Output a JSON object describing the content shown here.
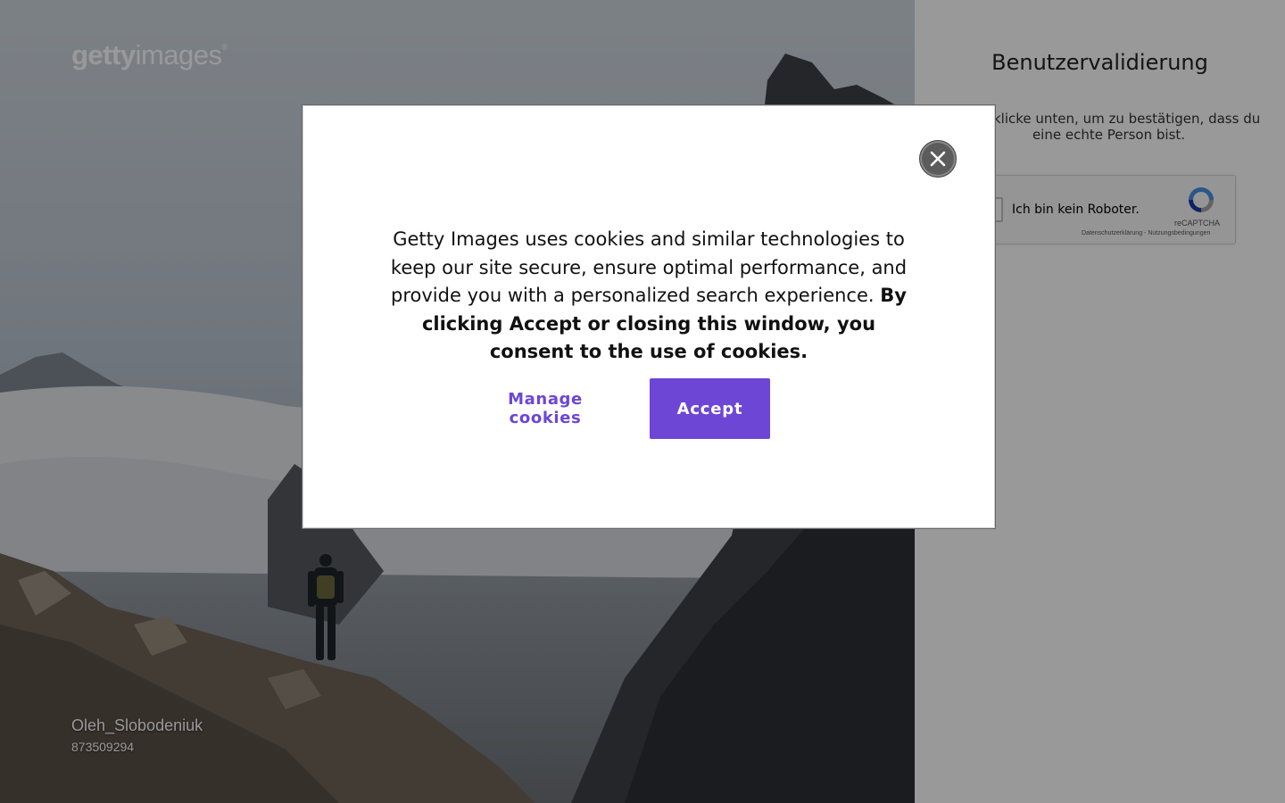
{
  "background": {
    "logo_bold": "getty",
    "logo_light": "images",
    "logo_mark": "®",
    "photographer": "Oleh_Slobodeniuk",
    "image_id": "873509294"
  },
  "validation": {
    "title": "Benutzervalidierung",
    "instructions": "Bitte klicke unten, um zu bestätigen, dass du eine echte Person bist.",
    "captcha": {
      "checkbox_label": "Ich bin kein Roboter.",
      "brand": "reCAPTCHA",
      "links": "Datenschutzerklärung - Nutzungsbedingungen"
    }
  },
  "cookie_dialog": {
    "message_plain": "Getty Images uses cookies and similar technologies to keep our site secure, ensure optimal performance, and provide you with a personalized search experience.",
    "message_bold": "By clicking Accept or closing this window, you consent to the use of cookies.",
    "manage_label": "Manage cookies",
    "accept_label": "Accept",
    "close_icon": "close-icon"
  },
  "colors": {
    "accent": "#6d46d6",
    "overlay": "rgba(0,0,0,0.40)"
  }
}
